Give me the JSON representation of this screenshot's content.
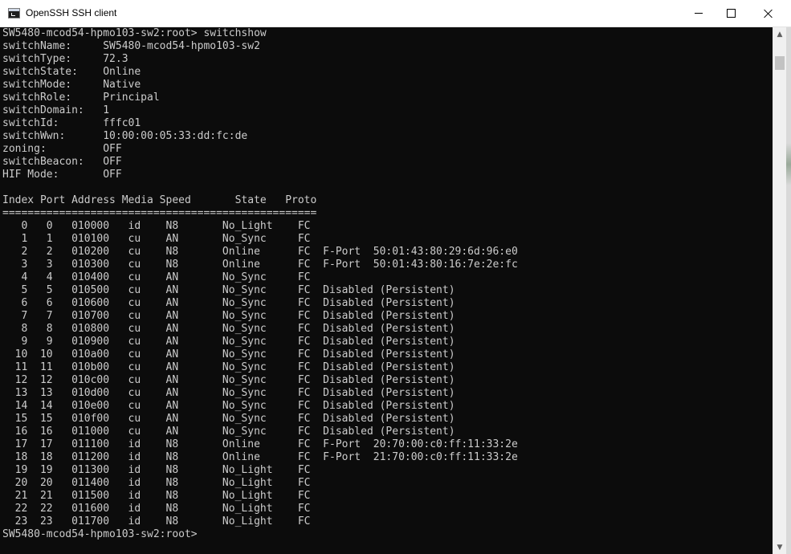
{
  "window": {
    "title": "OpenSSH SSH client",
    "app_icon": "console-icon",
    "controls": {
      "minimize_icon": "minimize-icon",
      "maximize_icon": "maximize-icon",
      "close_icon": "close-icon"
    }
  },
  "terminal": {
    "colors": {
      "background": "#0c0c0c",
      "foreground": "#cccccc"
    },
    "lines": [
      "SW5480-mcod54-hpmo103-sw2:root> switchshow",
      "switchName:     SW5480-mcod54-hpmo103-sw2",
      "switchType:     72.3",
      "switchState:    Online",
      "switchMode:     Native",
      "switchRole:     Principal",
      "switchDomain:   1",
      "switchId:       fffc01",
      "switchWwn:      10:00:00:05:33:dd:fc:de",
      "zoning:         OFF",
      "switchBeacon:   OFF",
      "HIF Mode:       OFF",
      "",
      "Index Port Address Media Speed       State   Proto",
      "==================================================",
      "   0   0   010000   id    N8       No_Light    FC",
      "   1   1   010100   cu    AN       No_Sync     FC",
      "   2   2   010200   cu    N8       Online      FC  F-Port  50:01:43:80:29:6d:96:e0",
      "   3   3   010300   cu    N8       Online      FC  F-Port  50:01:43:80:16:7e:2e:fc",
      "   4   4   010400   cu    AN       No_Sync     FC",
      "   5   5   010500   cu    AN       No_Sync     FC  Disabled (Persistent)",
      "   6   6   010600   cu    AN       No_Sync     FC  Disabled (Persistent)",
      "   7   7   010700   cu    AN       No_Sync     FC  Disabled (Persistent)",
      "   8   8   010800   cu    AN       No_Sync     FC  Disabled (Persistent)",
      "   9   9   010900   cu    AN       No_Sync     FC  Disabled (Persistent)",
      "  10  10   010a00   cu    AN       No_Sync     FC  Disabled (Persistent)",
      "  11  11   010b00   cu    AN       No_Sync     FC  Disabled (Persistent)",
      "  12  12   010c00   cu    AN       No_Sync     FC  Disabled (Persistent)",
      "  13  13   010d00   cu    AN       No_Sync     FC  Disabled (Persistent)",
      "  14  14   010e00   cu    AN       No_Sync     FC  Disabled (Persistent)",
      "  15  15   010f00   cu    AN       No_Sync     FC  Disabled (Persistent)",
      "  16  16   011000   cu    AN       No_Sync     FC  Disabled (Persistent)",
      "  17  17   011100   id    N8       Online      FC  F-Port  20:70:00:c0:ff:11:33:2e",
      "  18  18   011200   id    N8       Online      FC  F-Port  21:70:00:c0:ff:11:33:2e",
      "  19  19   011300   id    N8       No_Light    FC",
      "  20  20   011400   id    N8       No_Light    FC",
      "  21  21   011500   id    N8       No_Light    FC",
      "  22  22   011600   id    N8       No_Light    FC",
      "  23  23   011700   id    N8       No_Light    FC",
      "SW5480-mcod54-hpmo103-sw2:root>"
    ]
  },
  "scrollbar": {
    "up_icon": "scroll-up-arrow-icon",
    "down_icon": "scroll-down-arrow-icon",
    "up_glyph": "▲",
    "down_glyph": "▼"
  }
}
